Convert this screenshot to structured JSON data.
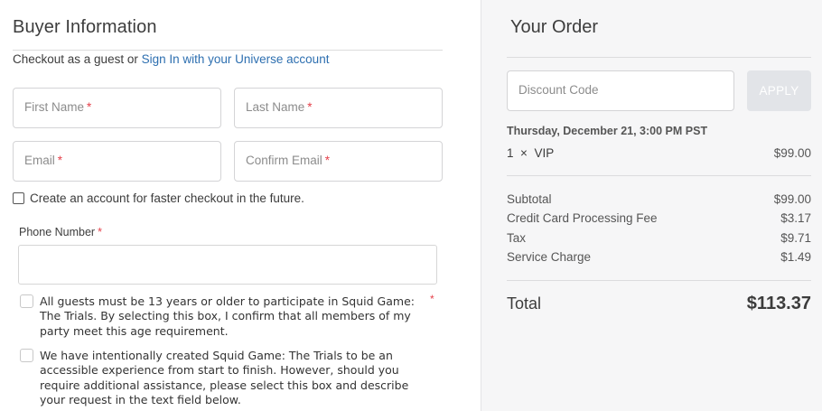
{
  "buyer": {
    "title": "Buyer Information",
    "guest_prefix": "Checkout as a guest or ",
    "signin_link": "Sign In with your Universe account",
    "fields": {
      "first_name": "First Name",
      "last_name": "Last Name",
      "email": "Email",
      "confirm_email": "Confirm Email"
    },
    "required_mark": "*",
    "create_account_label": "Create an account for faster checkout in the future.",
    "phone_label": "Phone Number",
    "phone_value": "",
    "age_consent": "All guests must be 13 years or older to participate in Squid Game: The Trials. By selecting this box, I confirm that all members of my party meet this age requirement.",
    "accessibility_consent": "We have intentionally created Squid Game: The Trials to be an accessible experience from start to finish. However, should you require additional assistance, please select this box and describe your request in the text field below."
  },
  "order": {
    "title": "Your Order",
    "discount_placeholder": "Discount Code",
    "apply_label": "APPLY",
    "event_datetime": "Thursday, December 21, 3:00 PM PST",
    "item": {
      "qty": "1",
      "times": "×",
      "name": "VIP",
      "price": "$99.00"
    },
    "summary": [
      {
        "label": "Subtotal",
        "value": "$99.00"
      },
      {
        "label": "Credit Card Processing Fee",
        "value": "$3.17"
      },
      {
        "label": "Tax",
        "value": "$9.71"
      },
      {
        "label": "Service Charge",
        "value": "$1.49"
      }
    ],
    "total_label": "Total",
    "total_value": "$113.37"
  },
  "colors": {
    "link": "#2d6fb0",
    "required": "#e5414b",
    "panel_bg": "#f6f6f7",
    "apply_bg": "#e2e4e8"
  }
}
